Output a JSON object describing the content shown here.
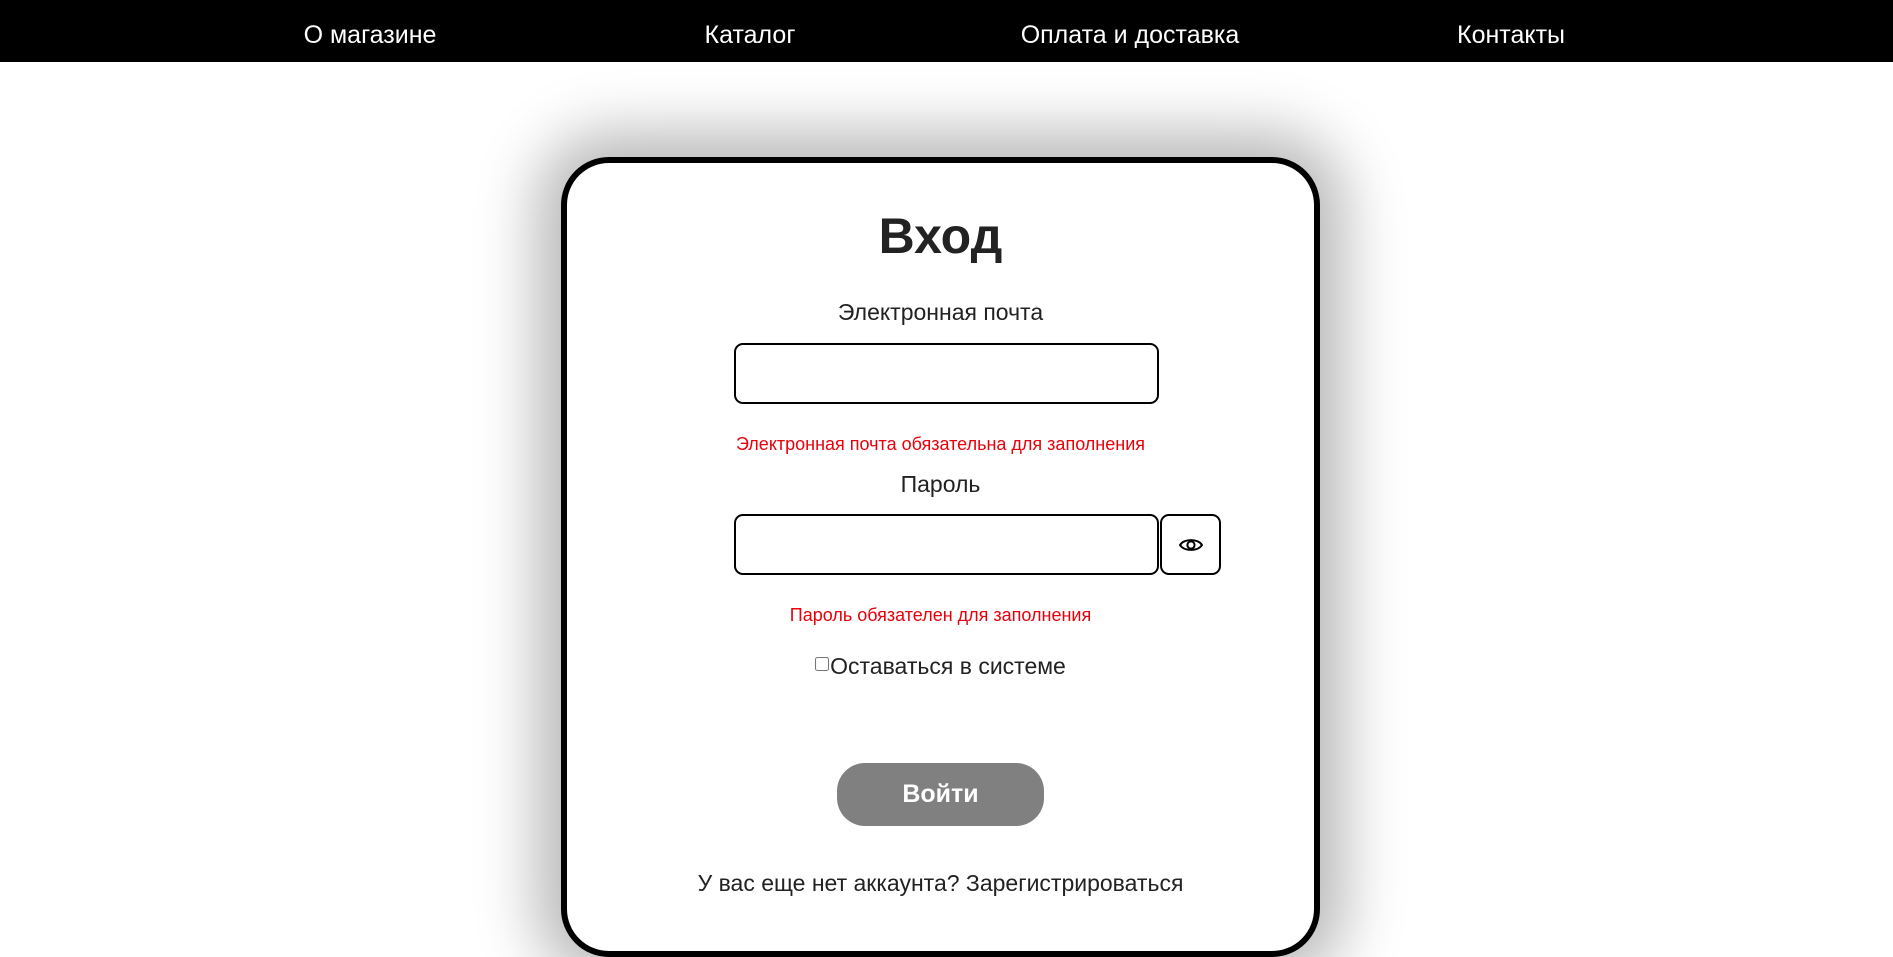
{
  "nav": {
    "items": [
      {
        "label": "О магазине"
      },
      {
        "label": "Каталог"
      },
      {
        "label": "Оплата и доставка"
      },
      {
        "label": "Контакты"
      }
    ]
  },
  "login": {
    "title": "Вход",
    "email": {
      "label": "Электронная почта",
      "value": "",
      "placeholder": "",
      "error": "Электронная почта обязательна для заполнения"
    },
    "password": {
      "label": "Пароль",
      "value": "",
      "placeholder": "",
      "error": "Пароль обязателен для заполнения",
      "toggle_icon": "eye-icon"
    },
    "remember": {
      "label": "Оставаться в системе",
      "checked": false
    },
    "submit_label": "Войти",
    "register_prompt": "У вас еще нет аккаунта?",
    "register_link": "Зарегистрироваться"
  },
  "colors": {
    "nav_bg": "#000000",
    "nav_text": "#ffffff",
    "error": "#e8000a",
    "button_bg": "#808080",
    "button_text": "#ffffff",
    "text": "#222222"
  }
}
